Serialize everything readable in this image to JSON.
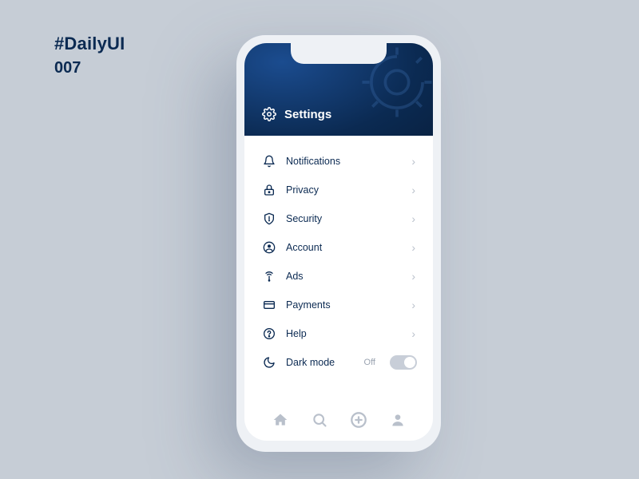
{
  "page": {
    "tag": "#DailyUI",
    "number": "007"
  },
  "header": {
    "title": "Settings"
  },
  "settings": [
    {
      "icon": "bell",
      "label": "Notifications"
    },
    {
      "icon": "lock",
      "label": "Privacy"
    },
    {
      "icon": "shield",
      "label": "Security"
    },
    {
      "icon": "account",
      "label": "Account"
    },
    {
      "icon": "ads",
      "label": "Ads"
    },
    {
      "icon": "card",
      "label": "Payments"
    },
    {
      "icon": "help",
      "label": "Help"
    }
  ],
  "darkmode": {
    "label": "Dark mode",
    "value_label": "Off",
    "value": false
  },
  "nav": {
    "items": [
      "home",
      "search",
      "add",
      "profile"
    ]
  },
  "colors": {
    "brand": "#0b2a52",
    "bg": "#c6cdd6"
  }
}
